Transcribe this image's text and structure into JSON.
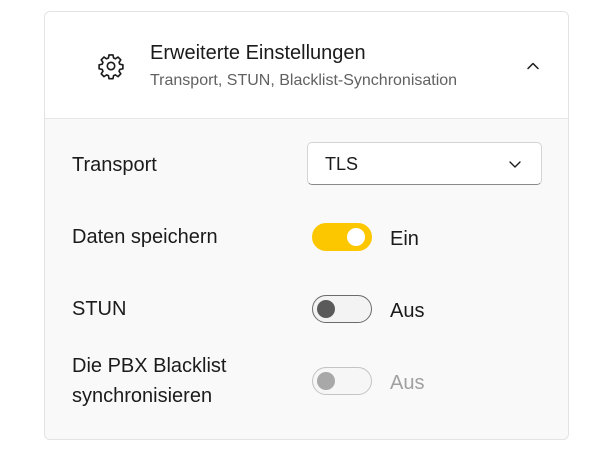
{
  "section": {
    "title": "Erweiterte Einstellungen",
    "subtitle": "Transport, STUN, Blacklist-Synchronisation",
    "expanded": true,
    "icon": "gear-icon"
  },
  "transport": {
    "label": "Transport",
    "value": "TLS"
  },
  "save_data": {
    "label": "Daten speichern",
    "state": "Ein",
    "on": true
  },
  "stun": {
    "label": "STUN",
    "state": "Aus",
    "on": false
  },
  "pbx_blacklist": {
    "label_line1": "Die PBX Blacklist",
    "label_line2": "synchronisieren",
    "state": "Aus",
    "on": false,
    "disabled": true
  },
  "colors": {
    "accent": "#fdc700",
    "text": "#1b1b1b",
    "subtext": "#616161",
    "disabled": "#a0a0a0"
  }
}
